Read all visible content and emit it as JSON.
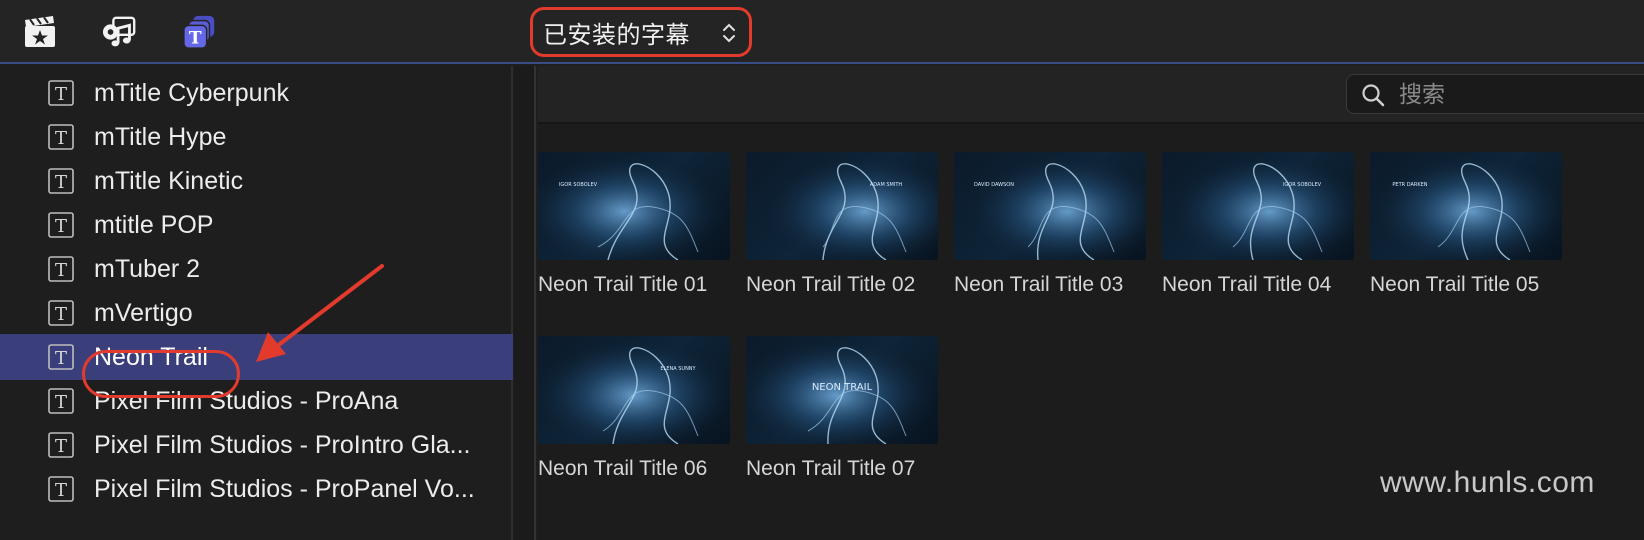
{
  "toolbar": {
    "icons": [
      "film-clapper-icon",
      "music-photo-icon",
      "titles-icon"
    ],
    "popup_label": "已安装的字幕",
    "accent": "#5b5fd6",
    "highlight": "#e23b2e"
  },
  "sidebar": {
    "items": [
      {
        "label": "mTitle Cyberpunk",
        "icon": "title-t-icon"
      },
      {
        "label": "mTitle Hype",
        "icon": "title-t-icon"
      },
      {
        "label": "mTitle Kinetic",
        "icon": "title-t-icon"
      },
      {
        "label": "mtitle POP",
        "icon": "title-t-icon"
      },
      {
        "label": "mTuber 2",
        "icon": "title-t-icon"
      },
      {
        "label": "mVertigo",
        "icon": "title-t-icon"
      },
      {
        "label": "Neon Trail",
        "icon": "title-t-icon",
        "selected": true
      },
      {
        "label": "Pixel Film Studios - ProAna",
        "icon": "title-t-icon"
      },
      {
        "label": "Pixel Film Studios - ProIntro Gla...",
        "icon": "title-t-icon"
      },
      {
        "label": "Pixel Film Studios - ProPanel Vo...",
        "icon": "title-t-icon"
      }
    ],
    "selected_color": "#3a3f7c"
  },
  "browser": {
    "search_placeholder": "搜索",
    "tiles": [
      {
        "label": "Neon Trail Title 01",
        "thumb_text": "IGOR SOBOLEV"
      },
      {
        "label": "Neon Trail Title 02",
        "thumb_text": "ADAM SMITH"
      },
      {
        "label": "Neon Trail Title 03",
        "thumb_text": "DAVID DAWSON"
      },
      {
        "label": "Neon Trail Title 04",
        "thumb_text": "IGOR SOBOLEV"
      },
      {
        "label": "Neon Trail Title 05",
        "thumb_text": "PETR DARKEN"
      },
      {
        "label": "Neon Trail Title 06",
        "thumb_text": "ELENA SUNNY"
      },
      {
        "label": "Neon Trail Title 07",
        "thumb_text": "NEON TRAIL"
      }
    ]
  },
  "watermark": "www.hunls.com"
}
